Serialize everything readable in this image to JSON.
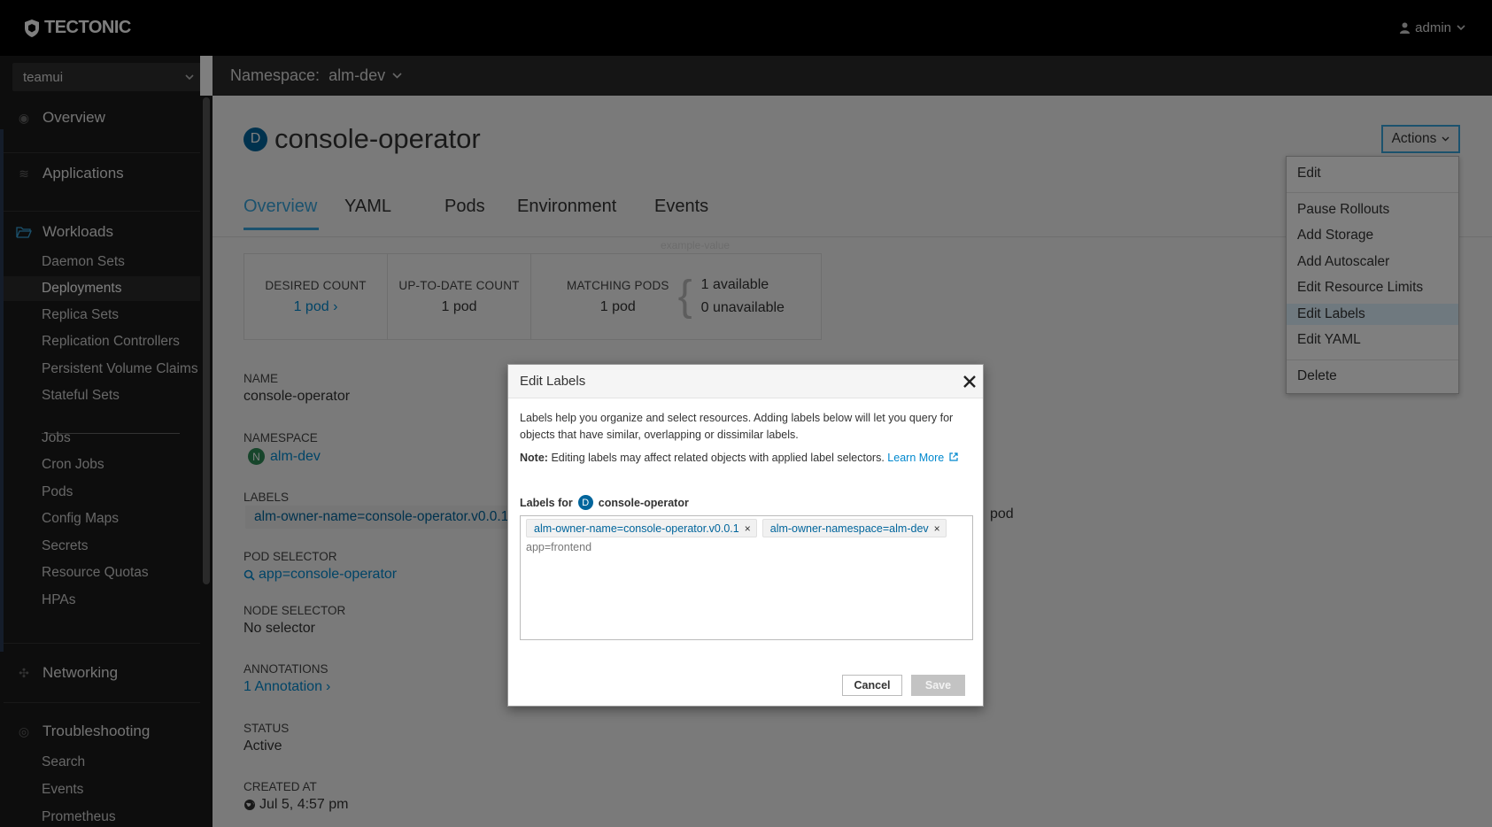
{
  "topbar": {
    "brand": "TECTONIC",
    "user": "admin"
  },
  "sidebar": {
    "cluster": "teamui",
    "sections": [
      {
        "label": "Overview"
      },
      {
        "label": "Applications"
      },
      {
        "label": "Workloads"
      },
      {
        "label": "Networking"
      },
      {
        "label": "Troubleshooting"
      }
    ],
    "workloads": [
      "Daemon Sets",
      "Deployments",
      "Replica Sets",
      "Replication Controllers",
      "Persistent Volume Claims",
      "Stateful Sets",
      "Jobs",
      "Cron Jobs",
      "Pods",
      "Config Maps",
      "Secrets",
      "Resource Quotas",
      "HPAs"
    ],
    "troubleshooting": [
      "Search",
      "Events",
      "Prometheus"
    ]
  },
  "namespace": {
    "label": "Namespace:",
    "value": "alm-dev"
  },
  "page": {
    "kind_badge": "D",
    "title": "console-operator",
    "actions_label": "Actions",
    "tabs": [
      "Overview",
      "YAML",
      "Pods",
      "Environment",
      "Events"
    ]
  },
  "counts": {
    "desired_label": "DESIRED COUNT",
    "desired_value": "1 pod",
    "uptodate_label": "UP-TO-DATE COUNT",
    "uptodate_value": "1 pod",
    "matching_label": "MATCHING PODS",
    "matching_value": "1 pod",
    "available": "1 available",
    "unavailable": "0 unavailable",
    "faint_text": "example-value"
  },
  "details": {
    "name_label": "NAME",
    "name_value": "console-operator",
    "namespace_label": "NAMESPACE",
    "namespace_badge": "N",
    "namespace_value": "alm-dev",
    "labels_label": "LABELS",
    "labels_value": "alm-owner-name=console-operator.v0.0.1",
    "pod_extra": "pod",
    "selector_label": "POD SELECTOR",
    "selector_value": "app=console-operator",
    "node_selector_label": "NODE SELECTOR",
    "node_selector_value": "No selector",
    "annotations_label": "ANNOTATIONS",
    "annotations_value": "1 Annotation",
    "status_label": "STATUS",
    "status_value": "Active",
    "created_label": "CREATED AT",
    "created_value": "Jul 5, 4:57 pm"
  },
  "dropdown": {
    "items": [
      "Edit",
      "Pause Rollouts",
      "Add Storage",
      "Add Autoscaler",
      "Edit Resource Limits",
      "Edit Labels",
      "Edit YAML",
      "Delete"
    ]
  },
  "modal": {
    "title": "Edit Labels",
    "description": "Labels help you organize and select resources. Adding labels below will let you query for objects that have similar, overlapping or dissimilar labels.",
    "note_prefix": "Note:",
    "note_text": "Editing labels may affect related objects with applied label selectors.",
    "learn_more": "Learn More",
    "labels_for": "Labels for",
    "resource_badge": "D",
    "resource_name": "console-operator",
    "chips": [
      "alm-owner-name=console-operator.v0.0.1",
      "alm-owner-namespace=alm-dev"
    ],
    "input_value": "app=frontend",
    "cancel": "Cancel",
    "save": "Save"
  }
}
